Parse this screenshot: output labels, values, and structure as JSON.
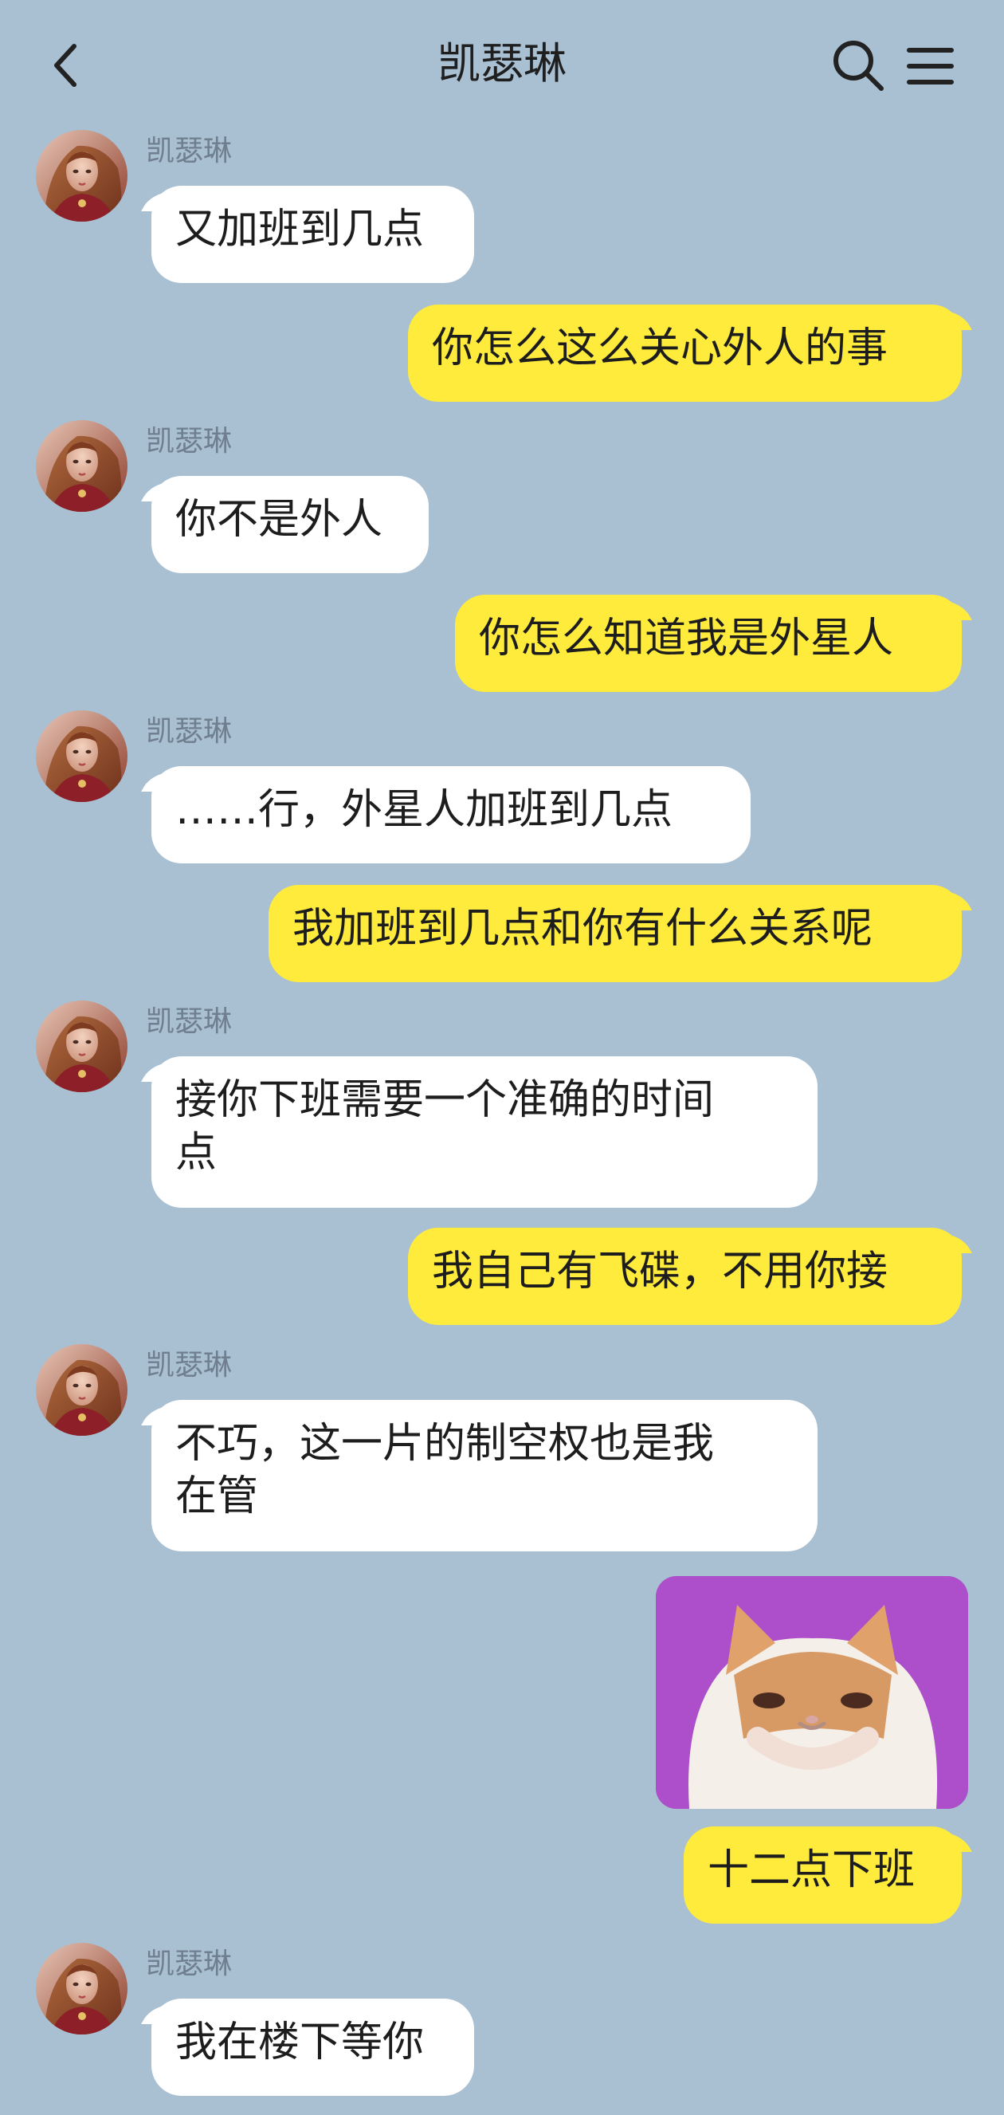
{
  "header": {
    "title": "凯瑟琳",
    "back_icon": "chevron-left-icon",
    "search_icon": "search-icon",
    "menu_icon": "menu-icon"
  },
  "messages": [
    {
      "from": "them",
      "sender": "凯瑟琳",
      "text": "又加班到几点"
    },
    {
      "from": "me",
      "text": "你怎么这么关心外人的事"
    },
    {
      "from": "them",
      "sender": "凯瑟琳",
      "text": "你不是外人"
    },
    {
      "from": "me",
      "text": "你怎么知道我是外星人"
    },
    {
      "from": "them",
      "sender": "凯瑟琳",
      "text": "……行，外星人加班到几点"
    },
    {
      "from": "me",
      "text": "我加班到几点和你有什么关系呢"
    },
    {
      "from": "them",
      "sender": "凯瑟琳",
      "text": "接你下班需要一个准确的时间\n点"
    },
    {
      "from": "me",
      "text": "我自己有飞碟，不用你接"
    },
    {
      "from": "them",
      "sender": "凯瑟琳",
      "text": "不巧，这一片的制空权也是我\n在管"
    },
    {
      "from": "me",
      "type": "sticker",
      "sticker": "cat-meme-sticker"
    },
    {
      "from": "me",
      "text": "十二点下班"
    },
    {
      "from": "them",
      "sender": "凯瑟琳",
      "text": "我在楼下等你"
    }
  ],
  "colors": {
    "background": "#a9bfd2",
    "incoming_bubble": "#ffffff",
    "outgoing_bubble": "#ffeb3b",
    "sender_name": "#6f7f8f"
  }
}
